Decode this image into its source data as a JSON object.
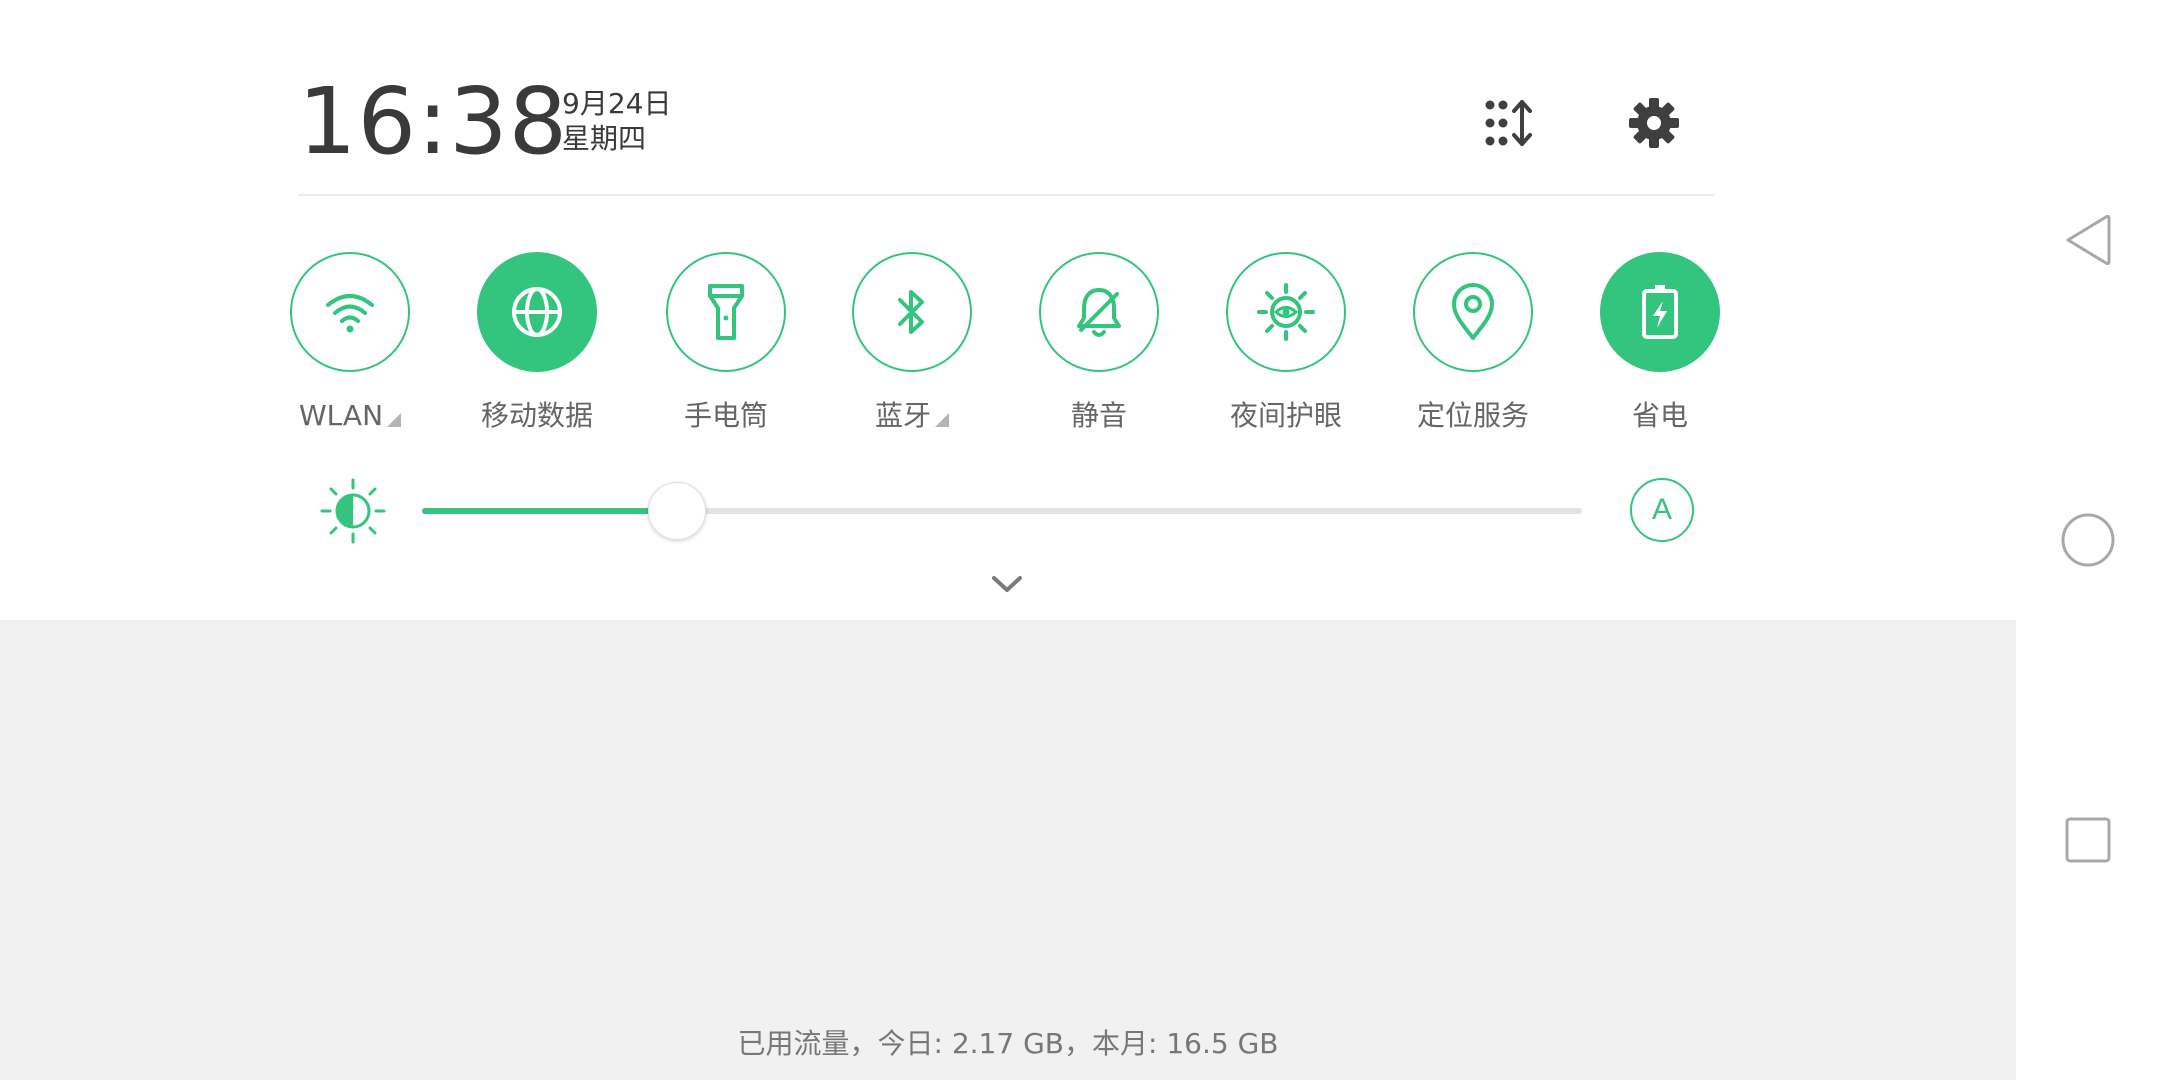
{
  "header": {
    "time": "16:38",
    "date": "9月24日",
    "weekday": "星期四"
  },
  "toggles": [
    {
      "label": "WLAN",
      "icon": "wifi-icon",
      "active": false,
      "has_more": true
    },
    {
      "label": "移动数据",
      "icon": "globe-icon",
      "active": true,
      "has_more": false
    },
    {
      "label": "手电筒",
      "icon": "flashlight-icon",
      "active": false,
      "has_more": false
    },
    {
      "label": "蓝牙",
      "icon": "bluetooth-icon",
      "active": false,
      "has_more": true
    },
    {
      "label": "静音",
      "icon": "bell-off-icon",
      "active": false,
      "has_more": false
    },
    {
      "label": "夜间护眼",
      "icon": "eye-sun-icon",
      "active": false,
      "has_more": false
    },
    {
      "label": "定位服务",
      "icon": "location-pin-icon",
      "active": false,
      "has_more": false
    },
    {
      "label": "省电",
      "icon": "battery-saver-icon",
      "active": true,
      "has_more": false
    }
  ],
  "brightness": {
    "level": 0.22,
    "auto_label": "A"
  },
  "footer": {
    "data_usage": "已用流量，今日: 2.17 GB，本月: 16.5 GB"
  },
  "colors": {
    "accent": "#33c47d",
    "panel_bg": "#ffffff",
    "lower_bg": "#f1f1f1",
    "text_dark": "#3a3a3a",
    "text_label": "#666666"
  }
}
